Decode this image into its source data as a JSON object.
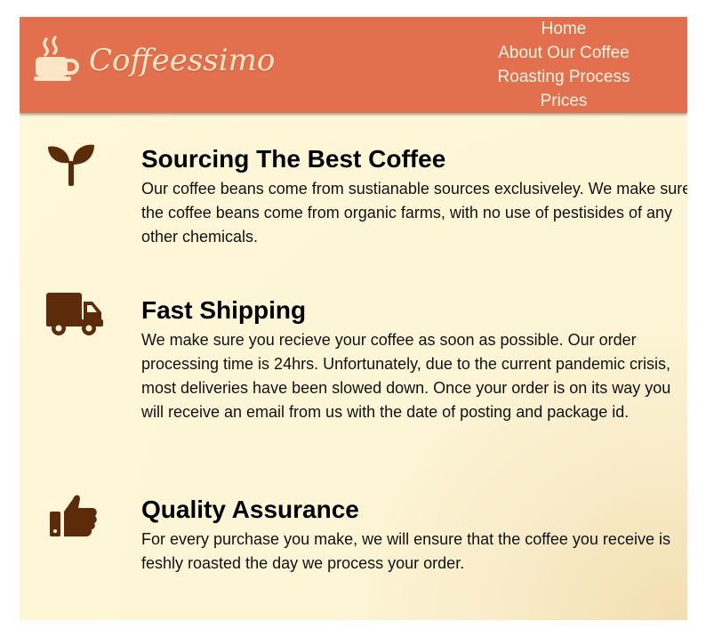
{
  "header": {
    "brand": "Coffeessimo",
    "logo_icon": "coffee-cup-icon",
    "background_color": "#e2704f",
    "nav": [
      {
        "label": "Home"
      },
      {
        "label": "About Our Coffee"
      },
      {
        "label": "Roasting Process"
      },
      {
        "label": "Prices"
      }
    ]
  },
  "features": [
    {
      "icon": "seedling-icon",
      "title": "Sourcing The Best Coffee",
      "text": "Our coffee beans come from sustianable sources exclusiveley. We make sure the coffee beans come from organic farms, with no use of pestisides of any other chemicals."
    },
    {
      "icon": "truck-icon",
      "title": "Fast Shipping",
      "text": "We make sure you recieve your coffee as soon as possible. Our order processing time is 24hrs. Unfortunately, due to the current pandemic crisis, most deliveries have been slowed down. Once your order is on its way you will receive an email from us with the date of posting and package id."
    },
    {
      "icon": "thumbs-up-icon",
      "title": "Quality Assurance",
      "text": "For every purchase you make, we will ensure that the coffee you receive is feshly roasted the day we process your order."
    }
  ],
  "colors": {
    "icon_brown": "#5c2c0a",
    "page_background": "#fef7d8"
  }
}
